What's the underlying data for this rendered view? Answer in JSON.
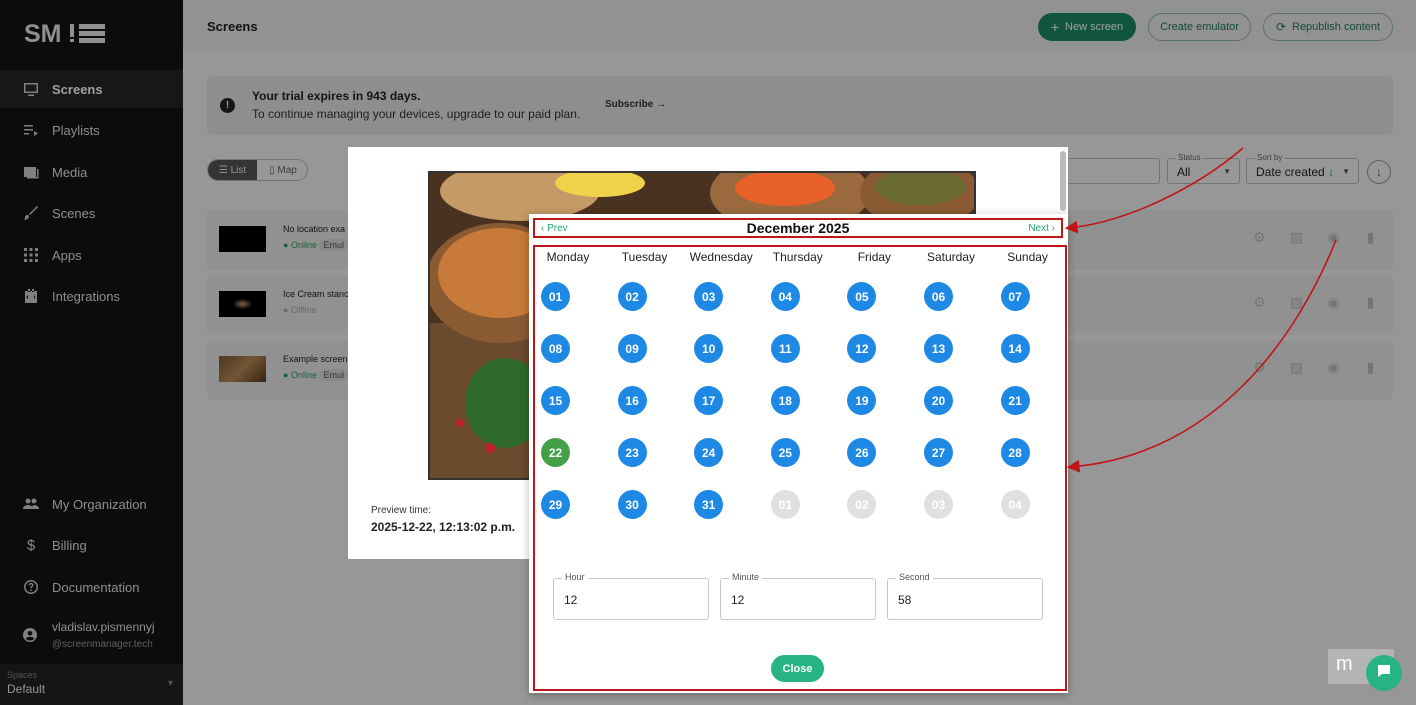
{
  "sidebar": {
    "logo": "SM",
    "items": [
      {
        "label": "Screens",
        "icon": "monitor-icon"
      },
      {
        "label": "Playlists",
        "icon": "playlist-icon"
      },
      {
        "label": "Media",
        "icon": "image-icon"
      },
      {
        "label": "Scenes",
        "icon": "brush-icon"
      },
      {
        "label": "Apps",
        "icon": "apps-grid-icon"
      },
      {
        "label": "Integrations",
        "icon": "integration-icon"
      }
    ],
    "bottom_items": [
      {
        "label": "My Organization",
        "icon": "people-icon"
      },
      {
        "label": "Billing",
        "icon": "dollar-icon"
      },
      {
        "label": "Documentation",
        "icon": "help-icon"
      }
    ],
    "user": {
      "name": "vladislav.pismennyj",
      "handle": "@screenmanager.tech"
    },
    "spaces": {
      "label": "Spaces",
      "value": "Default"
    }
  },
  "topbar": {
    "title": "Screens",
    "new_screen": "New screen",
    "create_emulator": "Create emulator",
    "republish": "Republish content"
  },
  "trial": {
    "title": "Your trial expires in 943 days.",
    "text": "To continue managing your devices, upgrade to our paid plan.",
    "subscribe": "Subscribe"
  },
  "view": {
    "list": "List",
    "map": "Map"
  },
  "filters": {
    "status_label": "Status",
    "status_value": "All",
    "sort_label": "Sort by",
    "sort_value": "Date created"
  },
  "screens": [
    {
      "name": "No location exa",
      "status": "Online",
      "badge": "Emul"
    },
    {
      "name": "Ice Cream stanc",
      "status": "Offline",
      "badge": ""
    },
    {
      "name": "Example screen",
      "status": "Online",
      "badge": "Emul"
    }
  ],
  "preview": {
    "time_label": "Preview time:",
    "time_value": "2025-12-22, 12:13:02 p.m."
  },
  "calendar": {
    "prev": "Prev",
    "next": "Next",
    "month_title": "December 2025",
    "weekdays": [
      "Monday",
      "Tuesday",
      "Wednesday",
      "Thursday",
      "Friday",
      "Saturday",
      "Sunday"
    ],
    "days": [
      "01",
      "02",
      "03",
      "04",
      "05",
      "06",
      "07",
      "08",
      "09",
      "10",
      "11",
      "12",
      "13",
      "14",
      "15",
      "16",
      "17",
      "18",
      "19",
      "20",
      "21",
      "22",
      "23",
      "24",
      "25",
      "26",
      "27",
      "28",
      "29",
      "30",
      "31",
      "01",
      "02",
      "03",
      "04"
    ],
    "selected_index": 21,
    "outside_start_index": 31,
    "colors": {
      "day": "#1e88e5",
      "selected": "#43a047",
      "outside": "#e0e0e0"
    },
    "hour_label": "Hour",
    "hour": "12",
    "minute_label": "Minute",
    "minute": "12",
    "second_label": "Second",
    "second": "58",
    "close": "Close"
  },
  "watermark": "m"
}
